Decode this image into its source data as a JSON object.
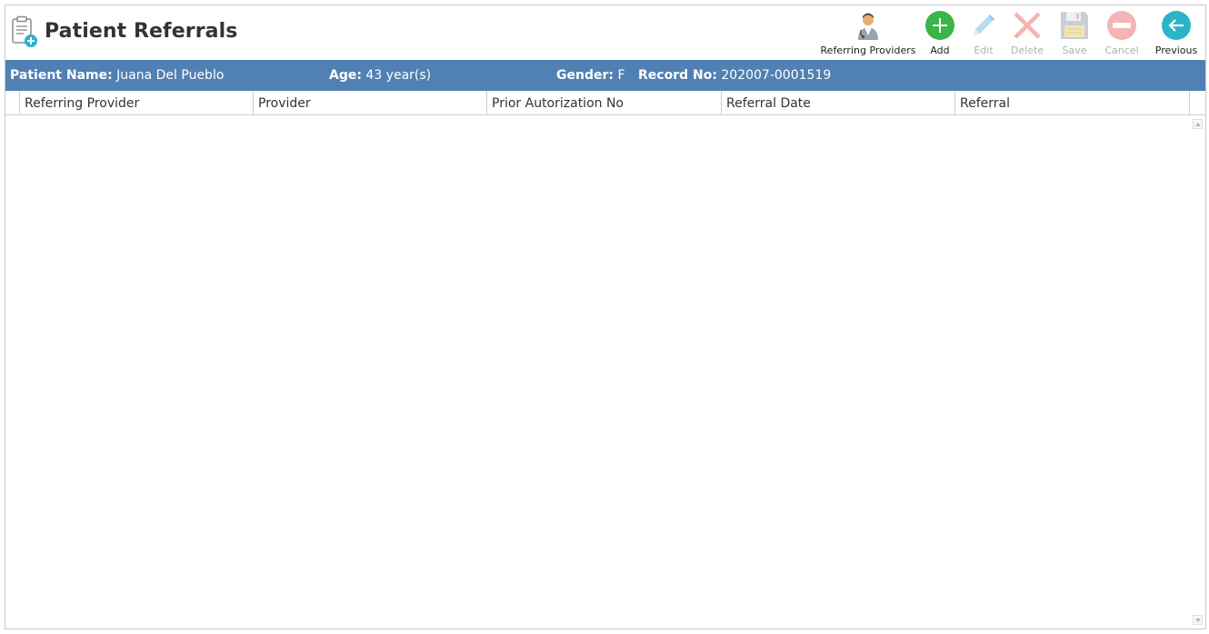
{
  "page": {
    "title": "Patient Referrals"
  },
  "toolbar": {
    "referring_providers": "Referring Providers",
    "add": "Add",
    "edit": "Edit",
    "delete": "Delete",
    "save": "Save",
    "cancel": "Cancel",
    "previous": "Previous"
  },
  "patient": {
    "name_label": "Patient Name:",
    "name_value": "Juana Del Pueblo",
    "age_label": "Age:",
    "age_value": "43 year(s)",
    "gender_label": "Gender:",
    "gender_value": "F",
    "record_label": "Record No:",
    "record_value": "202007-0001519"
  },
  "grid": {
    "columns": [
      "Referring Provider",
      "Provider",
      "Prior Autorization No",
      "Referral Date",
      "Referral"
    ]
  },
  "icons": {
    "title": "clipboard-add-icon",
    "referring_providers": "doctor-icon",
    "add": "plus-circle-icon",
    "edit": "pencil-icon",
    "delete": "x-icon",
    "save": "floppy-disk-icon",
    "cancel": "minus-circle-icon",
    "previous": "arrow-left-circle-icon"
  },
  "colors": {
    "patient_bar": "#5080b4",
    "add_green": "#3bb44a",
    "previous_teal": "#2bb3c8",
    "disabled_text": "#b0b0b0"
  }
}
